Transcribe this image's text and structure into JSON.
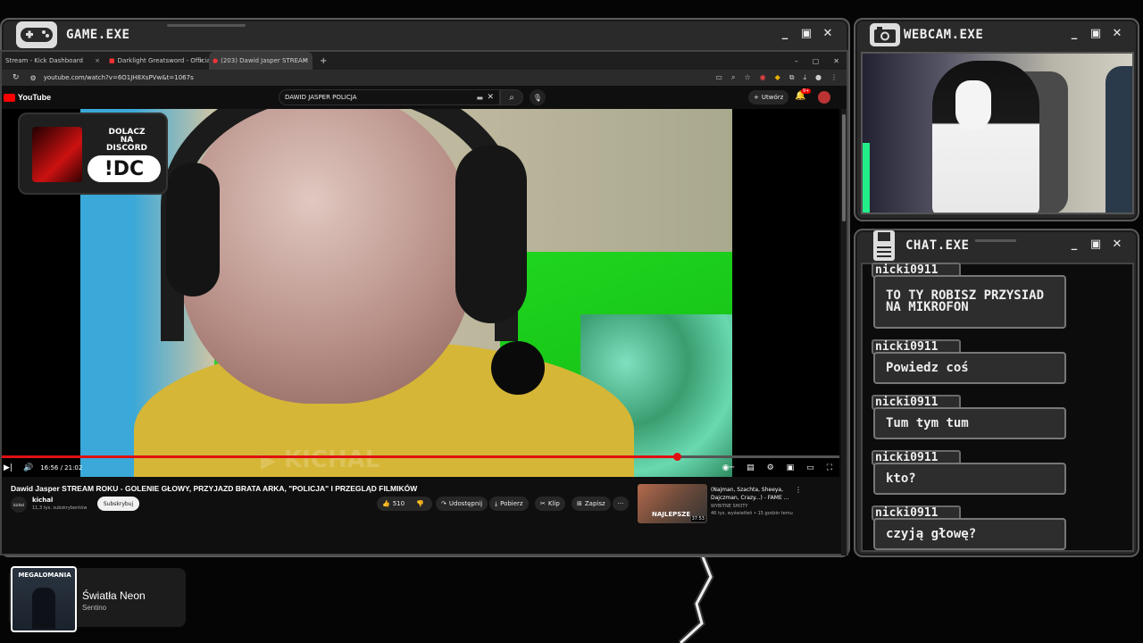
{
  "game_window": {
    "title": "GAME.EXE",
    "icon": "gamepad-icon",
    "controls": [
      "_",
      "▣",
      "✕"
    ]
  },
  "browser": {
    "tabs": [
      {
        "label": "Stream - Kick Dashboard",
        "close": "×"
      },
      {
        "label": "Darklight Greatsword - Official",
        "close": "×"
      },
      {
        "label": "(203) Dawid Jasper STREAM",
        "close": "×"
      }
    ],
    "new_tab": "+",
    "url": "youtube.com/watch?v=6O1JH8XsPVw&t=1067s",
    "window_controls": [
      "–",
      "▢",
      "✕"
    ]
  },
  "youtube": {
    "logo": "YouTube",
    "search_value": "DAWID JASPER POLICJA",
    "create_label": "Utwórz",
    "notif_count": "9+",
    "discord_banner": {
      "line1": "DOLACZ",
      "line2": "NA",
      "line3": "DISCORD",
      "code": "!DC"
    },
    "watermark": "KICHAL",
    "time": "16:56 / 21:02",
    "progress": 0.806,
    "video_title": "Dawid Jasper STREAM ROKU - GOLENIE GŁOWY, PRZYJAZD BRATA ARKA, \"POLICJA\" I PRZEGLĄD FILMIKÓW",
    "channel": {
      "name": "kichal",
      "subs": "11,3 tys. subskrybentów",
      "avatar_text": "kichal"
    },
    "subscribe_label": "Subskrybuj",
    "likes": "510",
    "share_label": "Udostępnij",
    "download_label": "Pobierz",
    "clip_label": "Klip",
    "save_label": "Zapisz",
    "more": "···",
    "recommended": {
      "title": "(Najman, Szachta, Sheeya, Dajczman, Crazy...) - FAME ...",
      "channel": "WYBITNE SHOTY",
      "meta": "46 tys. wyświetleń • 15 godzin temu",
      "thumb_text": "NAJLEPSZE",
      "duration": "37:53"
    }
  },
  "webcam_window": {
    "title": "WEBCAM.EXE",
    "icon": "camera-icon",
    "controls": [
      "_",
      "▣",
      "✕"
    ]
  },
  "chat_window": {
    "title": "CHAT.EXE",
    "icon": "floppy-icon",
    "controls": [
      "_",
      "▣",
      "✕"
    ],
    "messages": [
      {
        "user": "nicki0911",
        "text": "TO TY ROBISZ PRZYSIAD NA MIKROFON"
      },
      {
        "user": "nicki0911",
        "text": "Powiedz coś"
      },
      {
        "user": "nicki0911",
        "text": "Tum tym tum"
      },
      {
        "user": "nicki0911",
        "text": "kto?"
      },
      {
        "user": "nicki0911",
        "text": "czyją głowę?"
      }
    ]
  },
  "now_playing": {
    "song": "Światła Neon",
    "artist": "Sentino",
    "cover_text": "MEGALOMANIA"
  },
  "colors": {
    "window_bg": "#2a2a2a",
    "accent_red": "#e01010",
    "progress_red": "#e01010",
    "text_light": "#f2f2f2"
  }
}
